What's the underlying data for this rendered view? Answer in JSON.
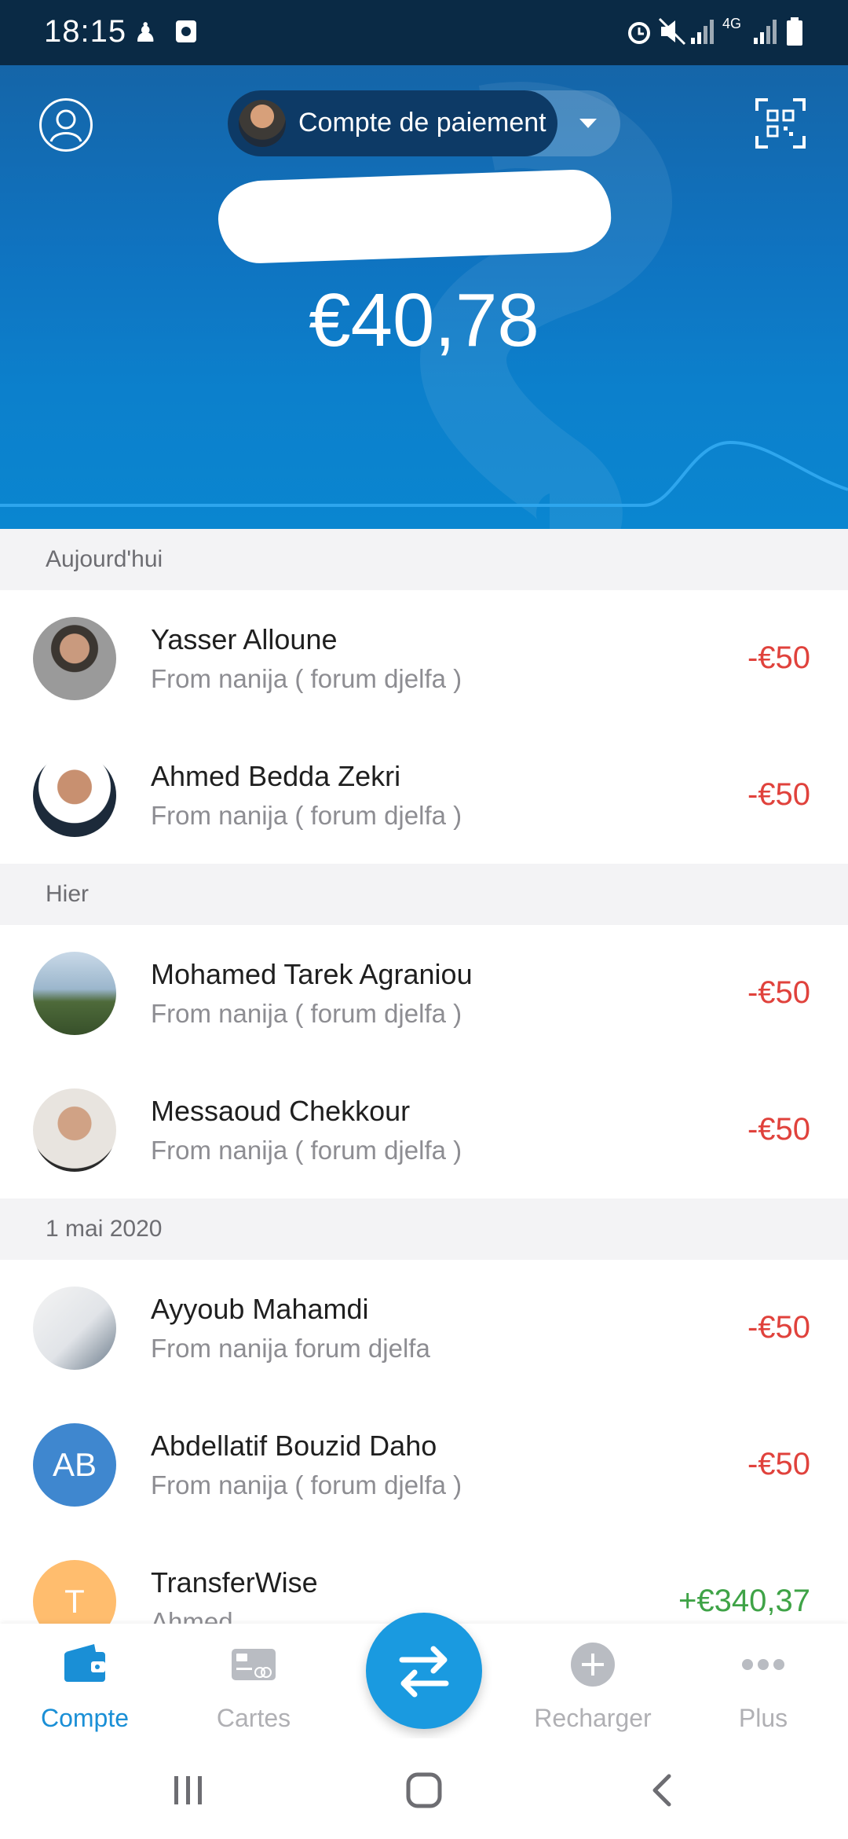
{
  "status_bar": {
    "time": "18:15",
    "icons": [
      "person-icon",
      "camera-icon",
      "alarm-icon",
      "mute-icon",
      "signal-icon",
      "4g-icon",
      "battery-icon"
    ],
    "network": "4G"
  },
  "header": {
    "account_label": "Compte de paiement",
    "balance": "€40,78",
    "colors": {
      "primary": "#0f73c0",
      "accent": "#1a9ae0"
    }
  },
  "sections": [
    {
      "label": "Aujourd'hui",
      "items": [
        {
          "name": "Yasser Alloune",
          "note": "From nanija ( forum djelfa )",
          "amount": "-€50"
        },
        {
          "name": "Ahmed Bedda Zekri",
          "note": "From nanija ( forum djelfa )",
          "amount": "-€50"
        }
      ]
    },
    {
      "label": "Hier",
      "items": [
        {
          "name": "Mohamed Tarek Agraniou",
          "note": "From nanija ( forum djelfa )",
          "amount": "-€50"
        },
        {
          "name": "Messaoud Chekkour",
          "note": "From nanija ( forum djelfa )",
          "amount": "-€50"
        }
      ]
    },
    {
      "label": "1 mai 2020",
      "items": [
        {
          "name": "Ayyoub Mahamdi",
          "note": "From nanija forum djelfa",
          "amount": "-€50"
        },
        {
          "name": "Abdellatif Bouzid Daho",
          "note": "From nanija ( forum djelfa )",
          "amount": "-€50",
          "initials": "AB"
        },
        {
          "name": "TransferWise",
          "note": "Ahmed",
          "amount": "+€340,37",
          "initials": "T"
        }
      ]
    }
  ],
  "bottom_nav": {
    "items": [
      {
        "label": "Compte",
        "icon": "wallet-icon",
        "active": true
      },
      {
        "label": "Cartes",
        "icon": "cards-icon"
      },
      {
        "label": "Recharger",
        "icon": "plus-circle-icon"
      },
      {
        "label": "Plus",
        "icon": "more-dots-icon"
      }
    ],
    "fab_icon": "transfer-arrows-icon"
  },
  "system_nav": [
    "recent-apps-icon",
    "home-icon",
    "back-icon"
  ]
}
